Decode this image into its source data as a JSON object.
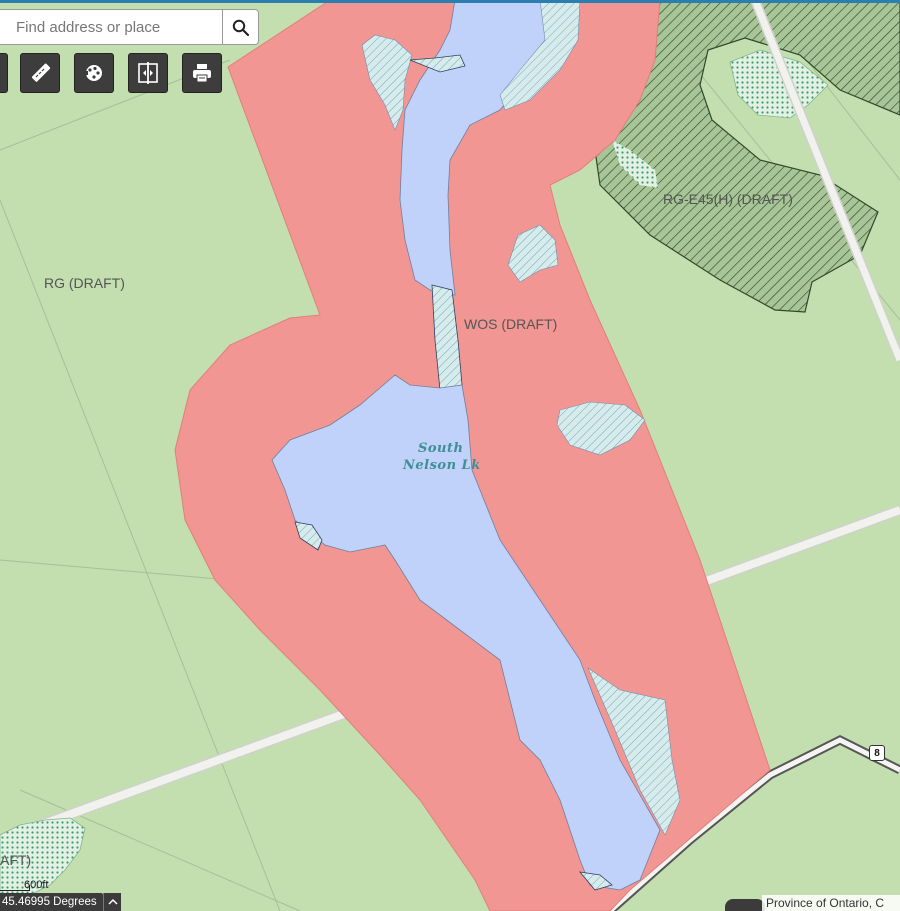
{
  "search": {
    "placeholder": "Find address or place"
  },
  "toolbar": {
    "tools": [
      {
        "name": "measure",
        "icon": "ruler-icon"
      },
      {
        "name": "layers",
        "icon": "palette-icon"
      },
      {
        "name": "swipe",
        "icon": "compare-icon"
      },
      {
        "name": "print",
        "icon": "printer-icon"
      }
    ]
  },
  "labels": {
    "rg": "RG (DRAFT)",
    "rge45": "RG-E45(H) (DRAFT)",
    "wos": "WOS (DRAFT)",
    "lake_line1": "South",
    "lake_line2": "Nelson Lk",
    "corner_label": "AFT)"
  },
  "route": {
    "number": "8"
  },
  "scale": {
    "label": "600ft"
  },
  "coordinates": {
    "text": "45.46995 Degrees"
  },
  "attribution": {
    "text": "Province of Ontario, C"
  },
  "colors": {
    "land": "#c3dfb0",
    "zone_wos": "#f29693",
    "water": "#c0d2fa",
    "zone_rge45": "#a7c597",
    "road": "#f0f0ec",
    "toolbar_accent": "#2b7fb0"
  }
}
